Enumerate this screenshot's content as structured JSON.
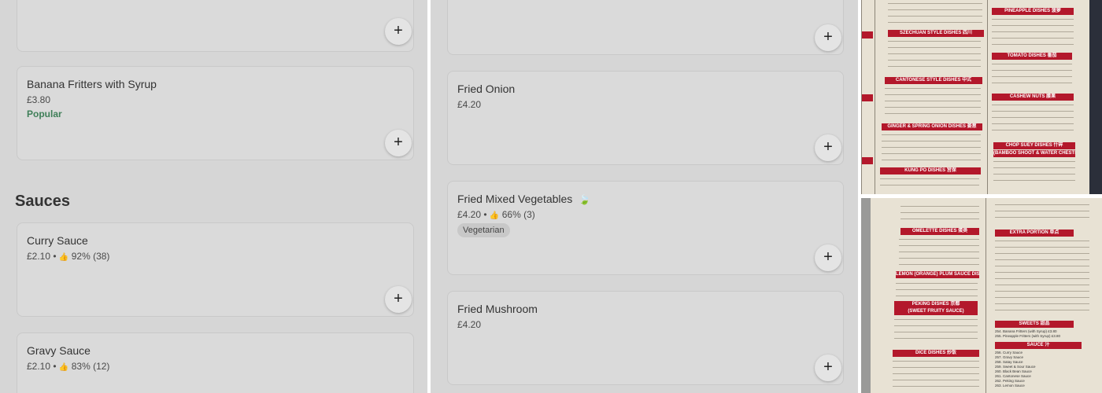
{
  "panel1": {
    "top_card_add": "+",
    "banana": {
      "name": "Banana Fritters with Syrup",
      "price": "£3.80",
      "badge": "Popular",
      "add": "+"
    },
    "section_title": "Sauces",
    "curry": {
      "name": "Curry Sauce",
      "price": "£2.10",
      "rating": "92% (38)",
      "add": "+"
    },
    "gravy": {
      "name": "Gravy Sauce",
      "price": "£2.10",
      "rating": "83% (12)"
    }
  },
  "panel2": {
    "top_card_add": "+",
    "onion": {
      "name": "Fried Onion",
      "price": "£4.20",
      "add": "+"
    },
    "mixed_veg": {
      "name": "Fried Mixed Vegetables",
      "price": "£4.20",
      "rating": "66% (3)",
      "tag": "Vegetarian",
      "add": "+"
    },
    "mushroom": {
      "name": "Fried Mushroom",
      "price": "£4.20",
      "add": "+"
    }
  },
  "separator": "•",
  "icons": {
    "thumb": "thumbs-up-icon",
    "leaf": "leaf-icon",
    "plus": "plus-icon"
  },
  "colors": {
    "popular": "#3f7f58",
    "menu_header": "#b3182b",
    "overlay": "#d6d6d6"
  },
  "menu_photo_top": {
    "headings": [
      "SZECHUAN STYLE DISHES 四川",
      "CANTONESE STYLE DISHES 中式",
      "GINGER & SPRING ONION DISHES 姜葱",
      "KUNG PO DISHES 宫保",
      "PINEAPPLE DISHES 菠萝",
      "TOMATO DISHES 番茄",
      "CASHEW NUTS 腰果",
      "CHOP SUEY DISHES 什碎",
      "(BAMBOO SHOOT & WATER CHESTNUT)"
    ]
  },
  "menu_photo_bottom": {
    "headings": [
      "OMELETTE DISHES 蛋类",
      "LEMON (ORANGE) PLUM SAUCE DISHES",
      "PEKING DISHES 京都",
      "(SWEET FRUITY SAUCE)",
      "DICE DISHES 炒饭",
      "EXTRA PORTION 单点",
      "SWEETS 甜品",
      "SAUCE 汁"
    ],
    "sweets": [
      "254. Banana Fritters (with Syrup)",
      "255. Pineapple Fritters (with Syrup)"
    ],
    "sweets_prices": [
      "£3.80",
      "£3.80"
    ],
    "sauces": [
      "256. Curry Sauce",
      "257. Gravy Sauce",
      "258. Satay Sauce",
      "259. Sweet & Sour Sauce",
      "260. Black Bean Sauce",
      "261. Cantonese Sauce",
      "262. Peking Sauce",
      "263. Lemon Sauce"
    ]
  }
}
